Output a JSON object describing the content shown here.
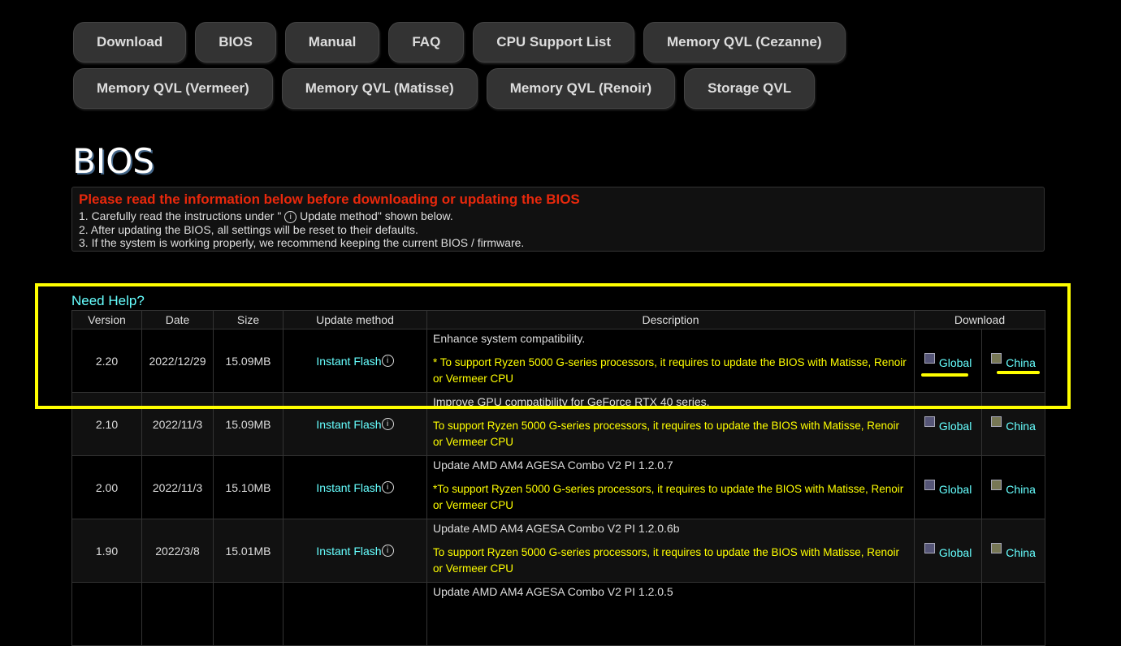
{
  "nav": {
    "row1": [
      "Download",
      "BIOS",
      "Manual",
      "FAQ",
      "CPU Support List",
      "Memory QVL (Cezanne)"
    ],
    "row2": [
      "Memory QVL (Vermeer)",
      "Memory QVL (Matisse)",
      "Memory QVL (Renoir)",
      "Storage QVL"
    ]
  },
  "page_title": "BIOS",
  "notice": {
    "heading": "Please read the information below before downloading or updating the BIOS",
    "line1a": "1. Carefully read the instructions under \" ",
    "line1b": " Update method\" shown below.",
    "info_glyph": "i",
    "line2": "2. After updating the BIOS, all settings will be reset to their defaults.",
    "line3": "3. If the system is working properly, we recommend keeping the current BIOS / firmware."
  },
  "help_link": "Need Help?",
  "table": {
    "headers": [
      "Version",
      "Date",
      "Size",
      "Update method",
      "Description",
      "Download"
    ],
    "rows": [
      {
        "version": "2.20",
        "date": "2022/12/29",
        "size": "15.09MB",
        "method": "Instant Flash",
        "desc": "Enhance system compatibility.",
        "note": "* To support Ryzen 5000 G-series processors, it requires to update the BIOS with Matisse, Renoir or Vermeer CPU",
        "global": "Global",
        "china": "China"
      },
      {
        "version": "2.10",
        "date": "2022/11/3",
        "size": "15.09MB",
        "method": "Instant Flash",
        "desc": "Improve GPU compatibility for GeForce RTX 40 series.",
        "note": "To support Ryzen 5000 G-series processors, it requires to update the BIOS with Matisse, Renoir or Vermeer CPU",
        "global": "Global",
        "china": "China"
      },
      {
        "version": "2.00",
        "date": "2022/11/3",
        "size": "15.10MB",
        "method": "Instant Flash",
        "desc": "Update AMD AM4 AGESA Combo V2 PI 1.2.0.7",
        "note": "*To support Ryzen 5000 G-series processors, it requires to update the BIOS with Matisse, Renoir or Vermeer CPU",
        "global": "Global",
        "china": "China"
      },
      {
        "version": "1.90",
        "date": "2022/3/8",
        "size": "15.01MB",
        "method": "Instant Flash",
        "desc": "Update AMD AM4 AGESA Combo V2 PI 1.2.0.6b",
        "note": "To support Ryzen 5000 G-series processors, it requires to update the BIOS with Matisse, Renoir or Vermeer CPU",
        "global": "Global",
        "china": "China"
      },
      {
        "version": "",
        "date": "",
        "size": "",
        "method": "",
        "desc": "Update AMD AM4 AGESA Combo V2 PI 1.2.0.5",
        "note": "",
        "global": "",
        "china": ""
      }
    ]
  },
  "colors": {
    "highlight": "#ffff00",
    "link": "#66ffff",
    "warning": "#e8280c"
  }
}
